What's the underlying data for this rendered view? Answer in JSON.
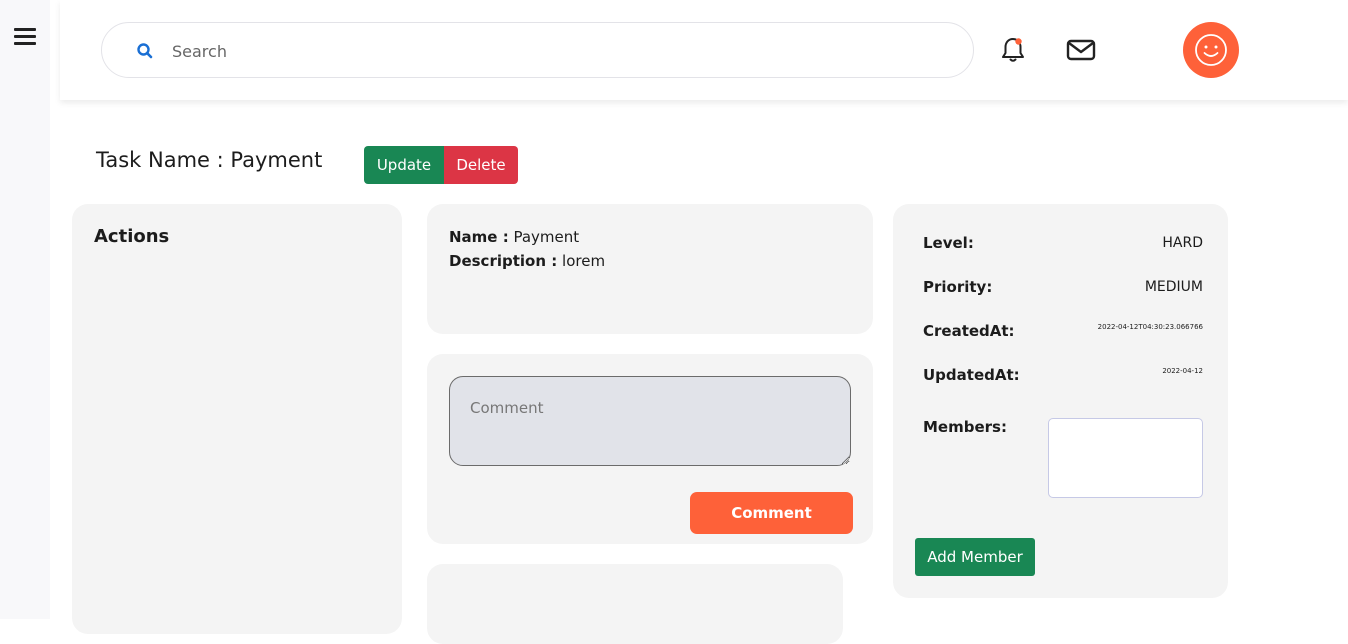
{
  "icons": {
    "menu": "hamburger-menu-icon",
    "search": "search-icon",
    "notifications": "bell-icon",
    "messages": "envelope-icon",
    "avatar": "smiley-face-icon"
  },
  "colors": {
    "accent": "#fe6139",
    "success": "#198754",
    "danger": "#dc3545",
    "search_icon": "#1a6fd4",
    "notification_dot": "#fe6139"
  },
  "search": {
    "placeholder": "Search",
    "value": ""
  },
  "task": {
    "title": "Task Name : Payment",
    "update_label": "Update",
    "delete_label": "Delete"
  },
  "actions_card": {
    "heading": "Actions"
  },
  "info_card": {
    "name_label": "Name :",
    "name_value": "Payment",
    "description_label": "Description :",
    "description_value": "lorem"
  },
  "comment_card": {
    "placeholder": "Comment",
    "value": "",
    "button_label": "Comment"
  },
  "details_card": {
    "level_label": "Level:",
    "level_value": "HARD",
    "priority_label": "Priority:",
    "priority_value": "MEDIUM",
    "created_label": "CreatedAt:",
    "created_value": "2022-04-12T04:30:23.066766",
    "updated_label": "UpdatedAt:",
    "updated_value": "2022-04-12",
    "members_label": "Members:",
    "add_member_label": "Add Member"
  }
}
